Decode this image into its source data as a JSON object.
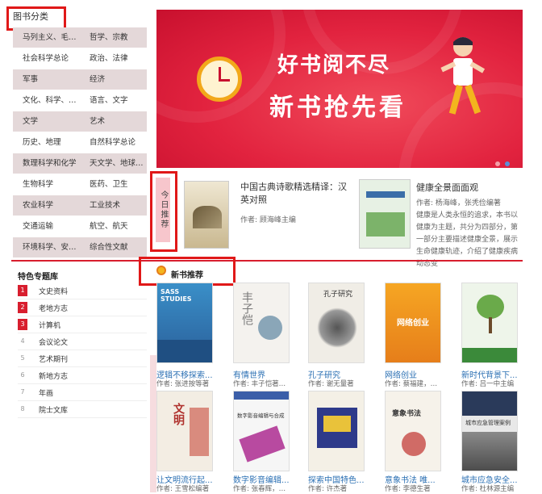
{
  "categories": {
    "title": "图书分类",
    "rows": [
      [
        "马列主义、毛泽...",
        "哲学、宗教"
      ],
      [
        "社会科学总论",
        "政治、法律"
      ],
      [
        "军事",
        "经济"
      ],
      [
        "文化、科学、教...",
        "语言、文字"
      ],
      [
        "文学",
        "艺术"
      ],
      [
        "历史、地理",
        "自然科学总论"
      ],
      [
        "数理科学和化学",
        "天文学、地球科学"
      ],
      [
        "生物科学",
        "医药、卫生"
      ],
      [
        "农业科学",
        "工业技术"
      ],
      [
        "交通运输",
        "航空、航天"
      ],
      [
        "环境科学、安全...",
        "综合性文献"
      ]
    ]
  },
  "banner": {
    "line1": "好书阅不尽",
    "line2": "新书抢先看"
  },
  "today": {
    "tag": "今日推荐",
    "book1": {
      "title": "中国古典诗歌精选精译：汉英对照",
      "author": "作者: 顾海峰主编"
    },
    "book2": {
      "title": "健康全景面面观",
      "author": "作者: 杨海峰，张秃俭编著",
      "desc": "健康是人类永恒的追求，本书以健康为主题，共分为四部分，第一部分主要描述健康全景，展示生命健康轨迹，介绍了健康疾病动态变"
    }
  },
  "special": {
    "title": "特色专题库",
    "items": [
      {
        "num": "1",
        "label": "文史资料"
      },
      {
        "num": "2",
        "label": "老地方志"
      },
      {
        "num": "3",
        "label": "计算机"
      },
      {
        "num": "4",
        "label": "会议论文"
      },
      {
        "num": "5",
        "label": "艺术期刊"
      },
      {
        "num": "6",
        "label": "新地方志"
      },
      {
        "num": "7",
        "label": "年画"
      },
      {
        "num": "8",
        "label": "院士文库"
      }
    ]
  },
  "newbooks": {
    "title": "新书推荐",
    "books": [
      {
        "title": "逻辑不移探索...",
        "author": "作者: 张进按等著",
        "cover": "SASS STUDIES"
      },
      {
        "title": "有情世界",
        "author": "作者: 丰子恺著；...",
        "cover": "丰子恺"
      },
      {
        "title": "孔子研究",
        "author": "作者: 谢无量著",
        "cover": "孔子研究"
      },
      {
        "title": "网络创业",
        "author": "作者: 蔡福建，陈...",
        "cover": "网络创业"
      },
      {
        "title": "新时代背景下...",
        "author": "作者: 吕一中主编",
        "cover": ""
      },
      {
        "title": "让文明流行起...",
        "author": "作者: 王雪松编著",
        "cover": "文明"
      },
      {
        "title": "数字影音编辑...",
        "author": "作者: 张春辉，葛...",
        "cover": "数字影音编辑与合成"
      },
      {
        "title": "探索中国特色...",
        "author": "作者: 许杰著",
        "cover": ""
      },
      {
        "title": "意象书法 唯...",
        "author": "作者: 李德生著",
        "cover": "意象书法"
      },
      {
        "title": "城市应急安全...",
        "author": "作者: 杜林源主编",
        "cover": "城市应急管理案例"
      }
    ]
  },
  "colors": {
    "accent": "#d81e2e",
    "link": "#2a6fb3"
  }
}
